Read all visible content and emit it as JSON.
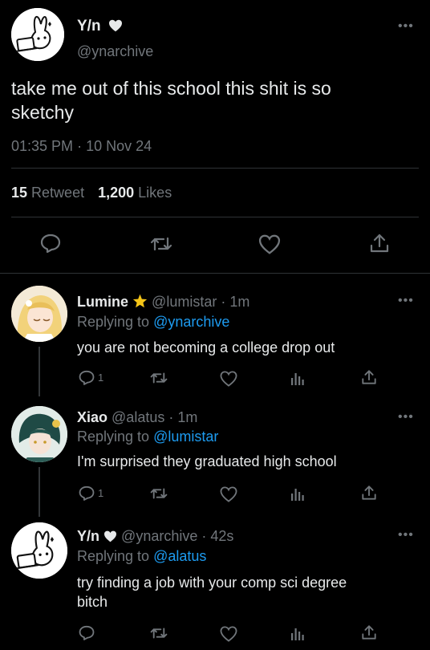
{
  "main_tweet": {
    "display_name": "Y/n",
    "handle": "@ynarchive",
    "text_line1": "take me out of this school this shit is so",
    "text_line2": "sketchy",
    "time": "01:35 PM",
    "dot": "·",
    "date": "10 Nov 24",
    "retweets_count": "15",
    "retweets_label": "Retweet",
    "likes_count": "1,200",
    "likes_label": "Likes"
  },
  "replies": [
    {
      "display_name": "Lumine",
      "handle": "@lumistar",
      "time": "· 1m",
      "replying_prefix": "Replying to",
      "replying_to": "@ynarchive",
      "text": "you are not becoming a college drop out",
      "reply_count": "1"
    },
    {
      "display_name": "Xiao",
      "handle": "@alatus",
      "time": "· 1m",
      "replying_prefix": "Replying to",
      "replying_to": "@lumistar",
      "text": "I'm surprised they graduated high school",
      "reply_count": "1"
    },
    {
      "display_name": "Y/n",
      "handle": "@ynarchive",
      "time": "· 42s",
      "replying_prefix": "Replying to",
      "replying_to": "@alatus",
      "text_line1": "try finding a job with your comp sci degree",
      "text_line2": "bitch"
    }
  ],
  "more_glyph": "•••",
  "colors": {
    "background": "#000000",
    "text": "#e7e9ea",
    "muted": "#71767b",
    "link": "#1d9bf0",
    "star": "#f5c518"
  }
}
